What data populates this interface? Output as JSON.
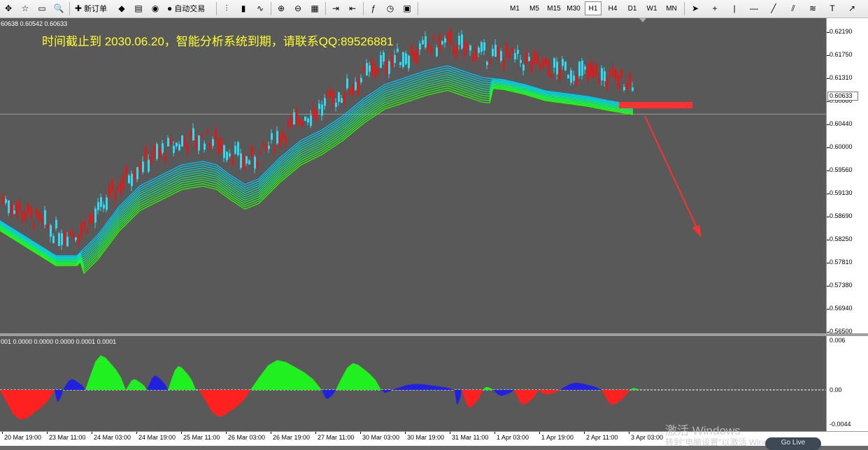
{
  "toolbar": {
    "items": [
      {
        "id": "crosshair-nav",
        "type": "icon",
        "glyph": "✥"
      },
      {
        "id": "favorites",
        "type": "icon",
        "glyph": "☆"
      },
      {
        "id": "window",
        "type": "icon",
        "glyph": "▭"
      },
      {
        "id": "zoom-tool",
        "type": "icon",
        "glyph": "🔍"
      },
      {
        "id": "new-order",
        "type": "labeled",
        "glyph": "✚",
        "label": "新订单"
      },
      {
        "id": "market-watch",
        "type": "icon",
        "glyph": "◆"
      },
      {
        "id": "data-window",
        "type": "icon",
        "glyph": "▤"
      },
      {
        "id": "terminal",
        "type": "icon",
        "glyph": "◉"
      },
      {
        "id": "auto-trading",
        "type": "labeled",
        "glyph": "●",
        "label": "自动交易"
      },
      {
        "id": "bar-chart",
        "type": "icon",
        "glyph": "⫶"
      },
      {
        "id": "candle-chart",
        "type": "icon",
        "glyph": "▮"
      },
      {
        "id": "line-chart",
        "type": "icon",
        "glyph": "∿"
      },
      {
        "id": "zoom-in",
        "type": "icon",
        "glyph": "⊕"
      },
      {
        "id": "zoom-out",
        "type": "icon",
        "glyph": "⊖"
      },
      {
        "id": "tile-windows",
        "type": "icon",
        "glyph": "▦"
      },
      {
        "id": "auto-scroll",
        "type": "icon",
        "glyph": "⇥"
      },
      {
        "id": "chart-shift",
        "type": "icon",
        "glyph": "⇤"
      },
      {
        "id": "indicators",
        "type": "icon",
        "glyph": "ƒ"
      },
      {
        "id": "periods",
        "type": "icon",
        "glyph": "◷"
      },
      {
        "id": "templates",
        "type": "icon",
        "glyph": "▣"
      }
    ],
    "timeframes": [
      "M1",
      "M5",
      "M15",
      "M30",
      "H1",
      "H4",
      "D1",
      "W1",
      "MN"
    ],
    "active_timeframe": "H1",
    "draw_tools": [
      {
        "id": "cursor",
        "glyph": "➤"
      },
      {
        "id": "crosshair",
        "glyph": "+"
      },
      {
        "id": "vertical-line",
        "glyph": "|"
      },
      {
        "id": "horizontal-line",
        "glyph": "—"
      },
      {
        "id": "trendline",
        "glyph": "╱"
      },
      {
        "id": "channel",
        "glyph": "⫽"
      },
      {
        "id": "fibonacci",
        "glyph": "≋"
      },
      {
        "id": "text",
        "glyph": "T"
      },
      {
        "id": "arrow",
        "glyph": "↗"
      }
    ]
  },
  "chart": {
    "ohlc_text": "60638 0.60542 0.60633",
    "notice": "时间截止到 2030.06.20，智能分析系统到期，请联系QQ:89526881",
    "current_price": "0.60633",
    "y_labels": [
      "0.62190",
      "0.61750",
      "0.61310",
      "0.60880",
      "0.60440",
      "0.60000",
      "0.59560",
      "0.59130",
      "0.58690",
      "0.58250",
      "0.57810",
      "0.57380",
      "0.56940",
      "0.56500"
    ],
    "y_max": 0.6219,
    "y_min": 0.565
  },
  "oscillator": {
    "label": "001 0.0000 0.0000 0.0000 0.0001 0.0001",
    "y_labels": [
      "0.006",
      "0.00",
      "-0.0044"
    ]
  },
  "x_axis": {
    "labels": [
      "20 Mar 19:00",
      "23 Mar 11:00",
      "24 Mar 03:00",
      "24 Mar 19:00",
      "25 Mar 11:00",
      "26 Mar 03:00",
      "26 Mar 19:00",
      "27 Mar 11:00",
      "30 Mar 03:00",
      "30 Mar 19:00",
      "31 Mar 11:00",
      "1 Apr 03:00",
      "1 Apr 19:00",
      "2 Apr 11:00",
      "3 Apr 03:00"
    ]
  },
  "watermark": {
    "title": "激活 Windows",
    "subtitle": "转到\"电脑设置\"以激活 Windows。"
  },
  "go_live_button": "Go Live"
}
